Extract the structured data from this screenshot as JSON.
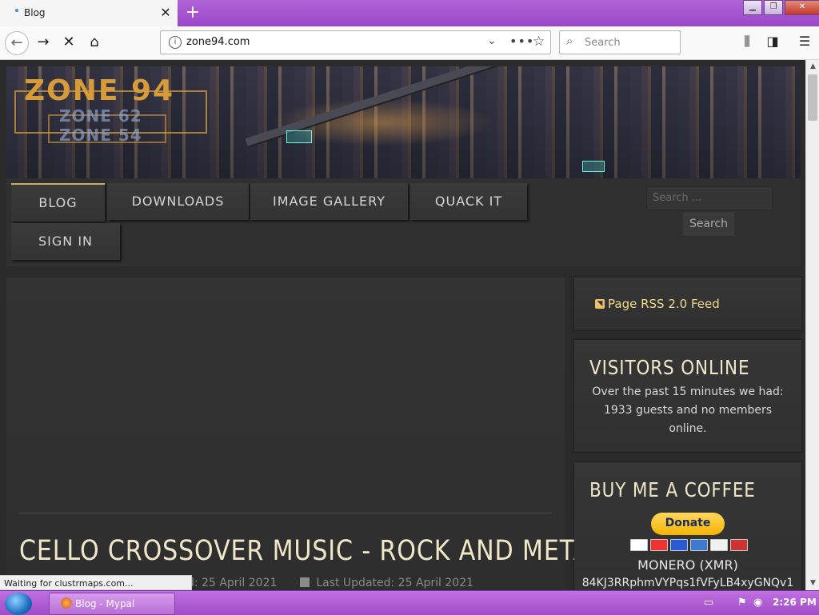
{
  "browser": {
    "tab_title": "Blog",
    "tab_close": "✕",
    "new_tab": "+",
    "url": "zone94.com",
    "search_placeholder": "Search"
  },
  "site": {
    "logo_main": "ZONE 94",
    "logo_sub1": "ZONE 62",
    "logo_sub2": "ZONE 54",
    "menu": [
      "BLOG",
      "DOWNLOADS",
      "IMAGE GALLERY",
      "QUACK IT",
      "SIGN IN"
    ],
    "search_placeholder": "Search ...",
    "search_button": "Search"
  },
  "article": {
    "title": "CELLO CROSSOVER MUSIC - ROCK AND METAL",
    "published_fragment": "d: 25 April 2021",
    "last_updated": "Last Updated: 25 April 2021"
  },
  "sidebar": {
    "rss_link": "Page RSS 2.0 Feed",
    "visitors_title": "VISITORS ONLINE",
    "visitors_text": "Over the past 15 minutes we had: 1933 guests and no members online.",
    "coffee_title": "BUY ME A COFFEE",
    "donate_label": "Donate",
    "monero_label": "MONERO (XMR)",
    "monero_address": "84KJ3RRphmVYPqs1fVFyLB4xyGNQv1"
  },
  "status_text": "Waiting for clustrmaps.com...",
  "taskbar": {
    "task_label": "Blog - Mypal",
    "clock": "2:26 PM"
  },
  "colors": {
    "tabbar": "#9b46c9",
    "page_bg": "#2b2b2b",
    "title_text": "#f0e7c9",
    "rss_link": "#f0d98a",
    "donate": "#f4b400"
  }
}
